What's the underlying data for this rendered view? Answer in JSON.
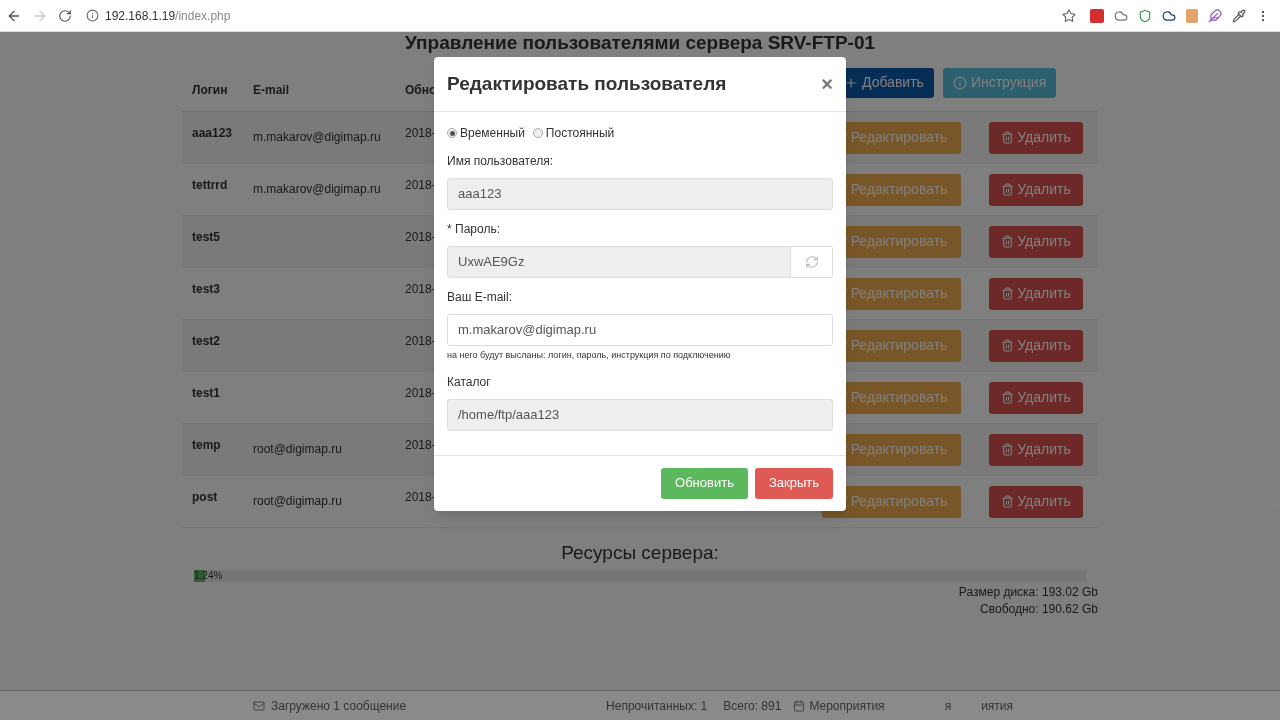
{
  "browser": {
    "url": {
      "host": "192.168.1.19",
      "path": "/index.php"
    }
  },
  "page": {
    "title": "Управление пользователями сервера SRV-FTP-01",
    "toolbar": [
      {
        "kind": "primary",
        "label": "Добавить"
      },
      {
        "kind": "info",
        "label": "Инструкция"
      }
    ],
    "table": {
      "columns": [
        "Логин",
        "E-mail",
        "Обно"
      ],
      "rows": [
        {
          "login": "aaa123",
          "email": "m.makarov@digimap.ru",
          "column_3": "2018-",
          "edit": "Редактировать",
          "delete": "Удалить"
        },
        {
          "login": "tettrrd",
          "email": "m.makarov@digimap.ru",
          "column_3": "2018-",
          "edit": "Редактировать",
          "delete": "Удалить"
        },
        {
          "login": "test5",
          "column_3": "2018-",
          "edit": "Редактировать",
          "delete": "Удалить"
        },
        {
          "login": "test3",
          "column_3": "2018-",
          "edit": "Редактировать",
          "delete": "Удалить"
        },
        {
          "login": "test2",
          "column_3": "2018-",
          "edit": "Редактировать",
          "delete": "Удалить"
        },
        {
          "login": "test1",
          "column_3": "2018-",
          "edit": "Редактировать",
          "delete": "Удалить"
        },
        {
          "login": "temp",
          "email": "root@digimap.ru",
          "column_3": "2018-",
          "edit": "Редактировать",
          "delete": "Удалить"
        },
        {
          "login": "post",
          "email": "root@digimap.ru",
          "column_3": "2018-",
          "edit": "Редактировать",
          "delete": "Удалить"
        }
      ]
    }
  },
  "resources": {
    "title": "Ресурсы сервера:",
    "disk": {
      "level": 0.0124,
      "label": "1.24%"
    },
    "size": "Размер диска: 193.02 Gb",
    "free": "Свободно: 190.62 Gb"
  },
  "modal": {
    "title": "Редактировать пользователя",
    "close": "×",
    "account_type": [
      {
        "label": "Временный",
        "selected": true
      },
      {
        "label": "Постоянный",
        "selected": false
      }
    ],
    "fields": [
      {
        "kind": "text",
        "label": "Имя пользователя:",
        "value": "aaa123",
        "disabled": true
      },
      {
        "kind": "with_button",
        "label": "* Пароль:",
        "value": "UxwAE9Gz",
        "disabled": true
      },
      {
        "kind": "text",
        "label": "Ваш E-mail:",
        "value": "m.makarov@digimap.ru",
        "disabled": false,
        "help": "на него будут высланы: логин, пароль, инструкция по подключению"
      },
      {
        "kind": "text",
        "label": "Каталог",
        "value": "/home/ftp/aaa123",
        "disabled": true
      }
    ],
    "buttons": [
      {
        "kind": "success",
        "label": "Обновить"
      },
      {
        "kind": "danger",
        "label": "Закрыть"
      }
    ]
  },
  "taskbar": [
    "Загружено 1 сообщение",
    "Непрочитанных: 1",
    "Всего: 891",
    "Мероприятия",
    "я",
    "иятия"
  ]
}
